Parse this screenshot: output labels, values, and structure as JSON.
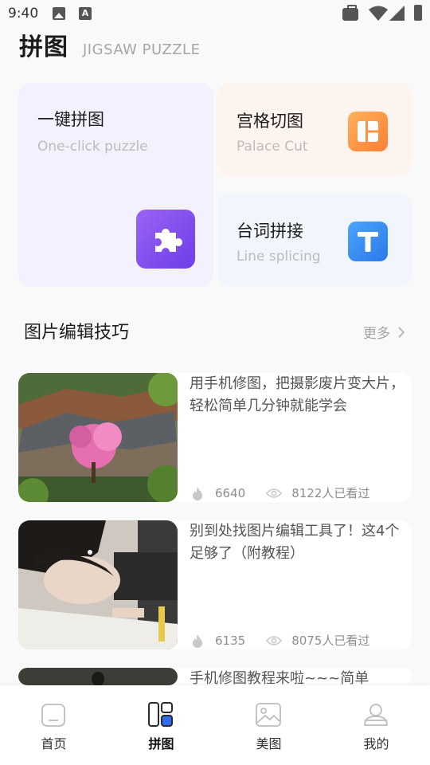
{
  "status_bar": {
    "time": "9:40",
    "icons": [
      "image-icon",
      "a-icon",
      "briefcase-icon",
      "wifi-icon",
      "cellular-icon",
      "battery-icon"
    ],
    "a_glyph": "A"
  },
  "header": {
    "title": "拼图",
    "subtitle": "JIGSAW PUZZLE"
  },
  "features": {
    "one_click": {
      "title": "一键拼图",
      "subtitle": "One-click puzzle",
      "icon": "puzzle-piece-icon",
      "color": "#7c4bef"
    },
    "palace_cut": {
      "title": "宫格切图",
      "subtitle": "Palace Cut",
      "icon": "grid-layout-icon",
      "color": "#fd9443"
    },
    "line_splicing": {
      "title": "台词拼接",
      "subtitle": "Line splicing",
      "icon": "text-t-icon",
      "color": "#3a8df3"
    }
  },
  "section": {
    "title": "图片编辑技巧",
    "more": "更多"
  },
  "articles": [
    {
      "title": "用手机修图，把摄影废片变大片，轻松简单几分钟就能学会",
      "likes": "6640",
      "views": "8122人已看过"
    },
    {
      "title": "别到处找图片编辑工具了！这4个足够了（附教程）",
      "likes": "6135",
      "views": "8075人已看过"
    },
    {
      "title": "手机修图教程来啦~~~简单"
    }
  ],
  "bottom_nav": {
    "items": [
      {
        "label": "首页",
        "icon": "home-icon"
      },
      {
        "label": "拼图",
        "icon": "collage-icon",
        "active": true
      },
      {
        "label": "美图",
        "icon": "picture-icon"
      },
      {
        "label": "我的",
        "icon": "profile-icon"
      }
    ]
  },
  "colors": {
    "active_nav_accent": "#2e6cf0",
    "background": "#f9f9f9"
  }
}
